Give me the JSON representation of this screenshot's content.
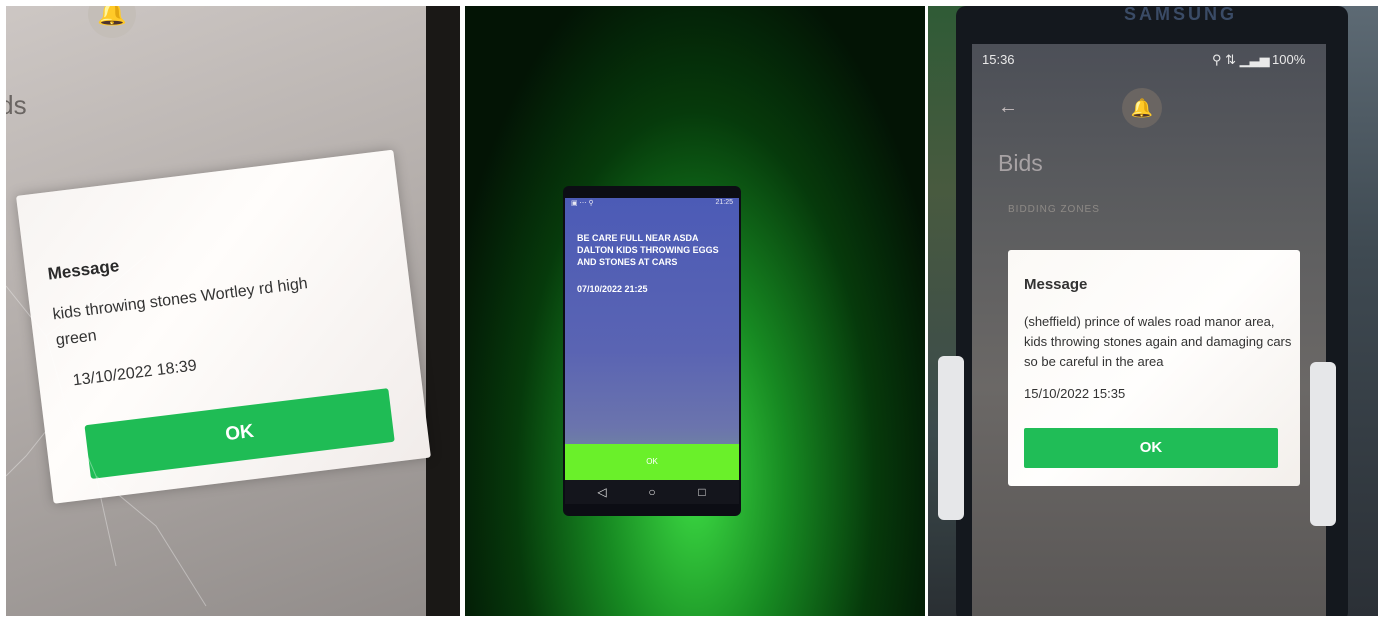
{
  "photo1": {
    "back_icon": "back-arrow-icon",
    "bell_icon": "bell-icon",
    "page_title": "Bids",
    "dialog": {
      "title": "Message",
      "text": "kids throwing stones Wortley rd high green",
      "date": "13/10/2022 18:39",
      "ok": "OK"
    },
    "colors": {
      "ok_button": "#1fbc55"
    }
  },
  "photo2": {
    "status_time": "21:25",
    "alert_text": "BE CARE FULL NEAR ASDA DALTON KIDS THROWING EGGS AND STONES AT CARS",
    "alert_date": "07/10/2022 21:25",
    "ok": "OK",
    "nav": {
      "back": "◁",
      "home": "○",
      "recents": "□"
    },
    "colors": {
      "ok_bar": "#6af02a",
      "screen": "#5060b0"
    }
  },
  "photo3": {
    "brand": "SAMSUNG",
    "status": {
      "time": "15:36",
      "battery": "100%"
    },
    "page_title": "Bids",
    "section": "BIDDING ZONES",
    "dialog": {
      "title": "Message",
      "text": "(sheffield) prince of wales road manor area, kids throwing stones again and damaging cars so be careful in the area",
      "date": "15/10/2022 15:35",
      "ok": "OK"
    },
    "colors": {
      "ok_button": "#20bd57"
    }
  }
}
